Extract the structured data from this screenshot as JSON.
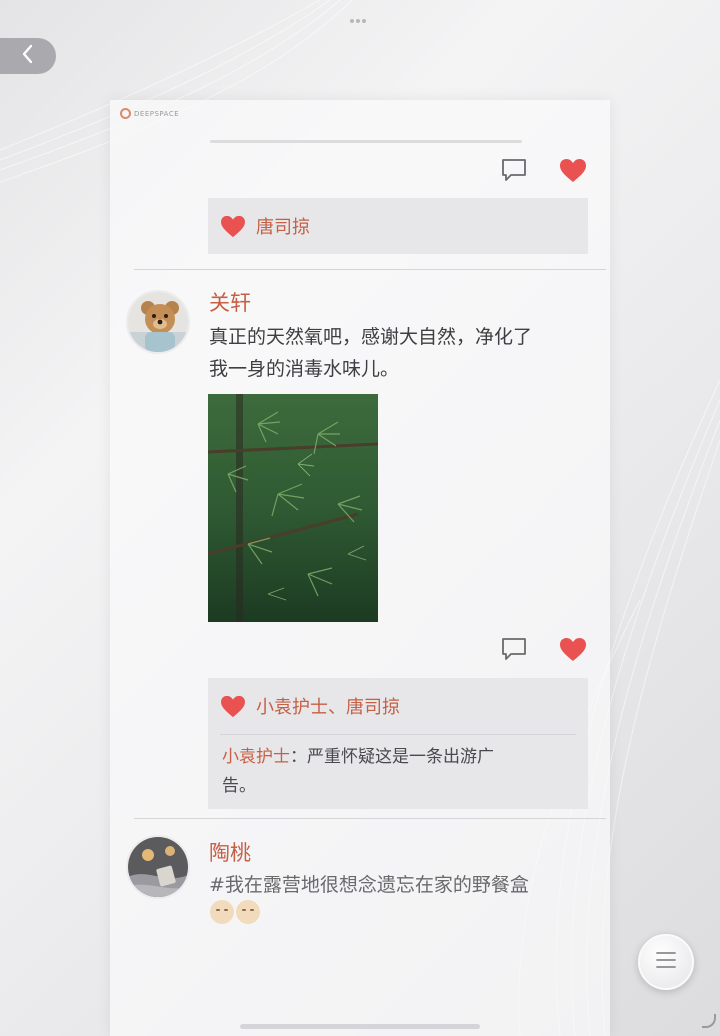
{
  "app": {
    "brand": "DEEPSPACE"
  },
  "nav": {
    "back_icon": "chevron-left-icon",
    "menu_icon": "menu-lines-icon"
  },
  "colors": {
    "accent": "#c65f44",
    "heart": "#ea5252",
    "panel_bg": "#f6f6f7",
    "likes_bg": "#e7e7ea"
  },
  "posts": [
    {
      "likes": "唐司掠"
    },
    {
      "name": "关轩",
      "text_line1": "真正的天然氧吧，感谢大自然，净化了",
      "text_line2": "我一身的消毒水味儿。",
      "avatar": "teddy-bear",
      "photo": "pine-branches",
      "likes": "小袁护士、唐司掠",
      "comments": [
        {
          "author": "小袁护士",
          "separator": "：",
          "text_line1": "严重怀疑这是一条出游广",
          "text_line2": "告。"
        }
      ]
    },
    {
      "name": "陶桃",
      "text": "#我在露营地很想念遗忘在家的野餐盒",
      "avatar": "candle-blanket"
    }
  ]
}
